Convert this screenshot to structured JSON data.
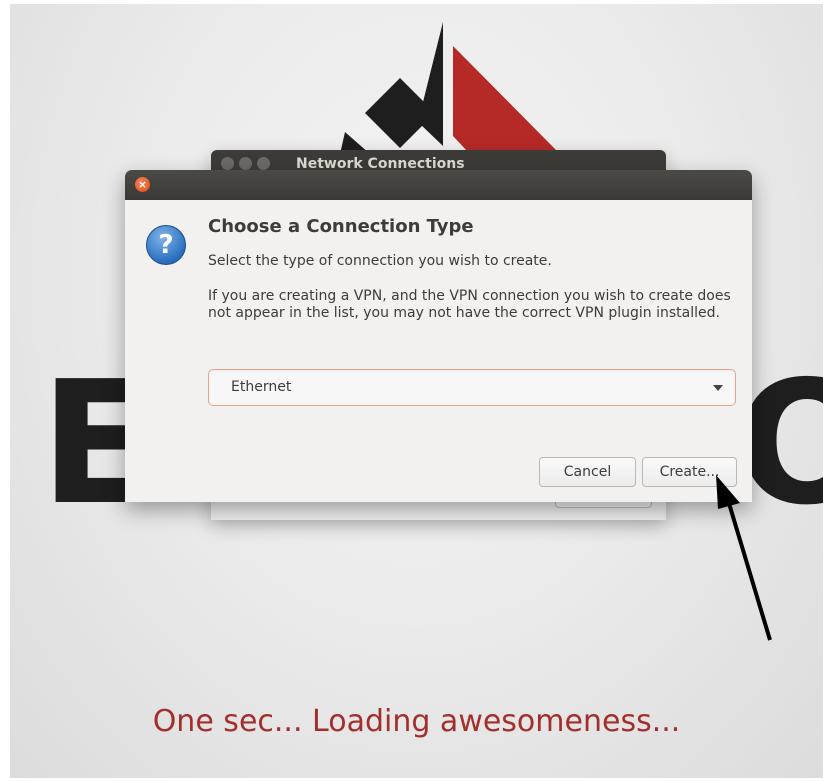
{
  "background": {
    "letter_left": "E",
    "letter_right": "O",
    "loading_text": "One sec... Loading awesomeness..."
  },
  "background_window": {
    "title": "Network Connections"
  },
  "dialog": {
    "close_glyph": "×",
    "icon_glyph": "?",
    "heading": "Choose a Connection Type",
    "subtext": "Select the type of connection you wish to create.",
    "description": "If you are creating a VPN, and the VPN connection you wish to create does not appear in the list, you may not have the correct VPN plugin installed.",
    "connection_type": {
      "selected": "Ethernet"
    },
    "buttons": {
      "cancel": "Cancel",
      "create": "Create..."
    }
  },
  "colors": {
    "logo_red": "#b52a26",
    "logo_black": "#1e1e1e",
    "loading_red": "#a42e2b",
    "titlebar": "#3c3b37",
    "close_orange": "#df4b16",
    "question_blue": "#2a6fbd"
  },
  "icons": {
    "close": "close-icon",
    "question": "question-icon",
    "dropdown": "chevron-down-icon",
    "annotation": "arrow-pointer"
  }
}
